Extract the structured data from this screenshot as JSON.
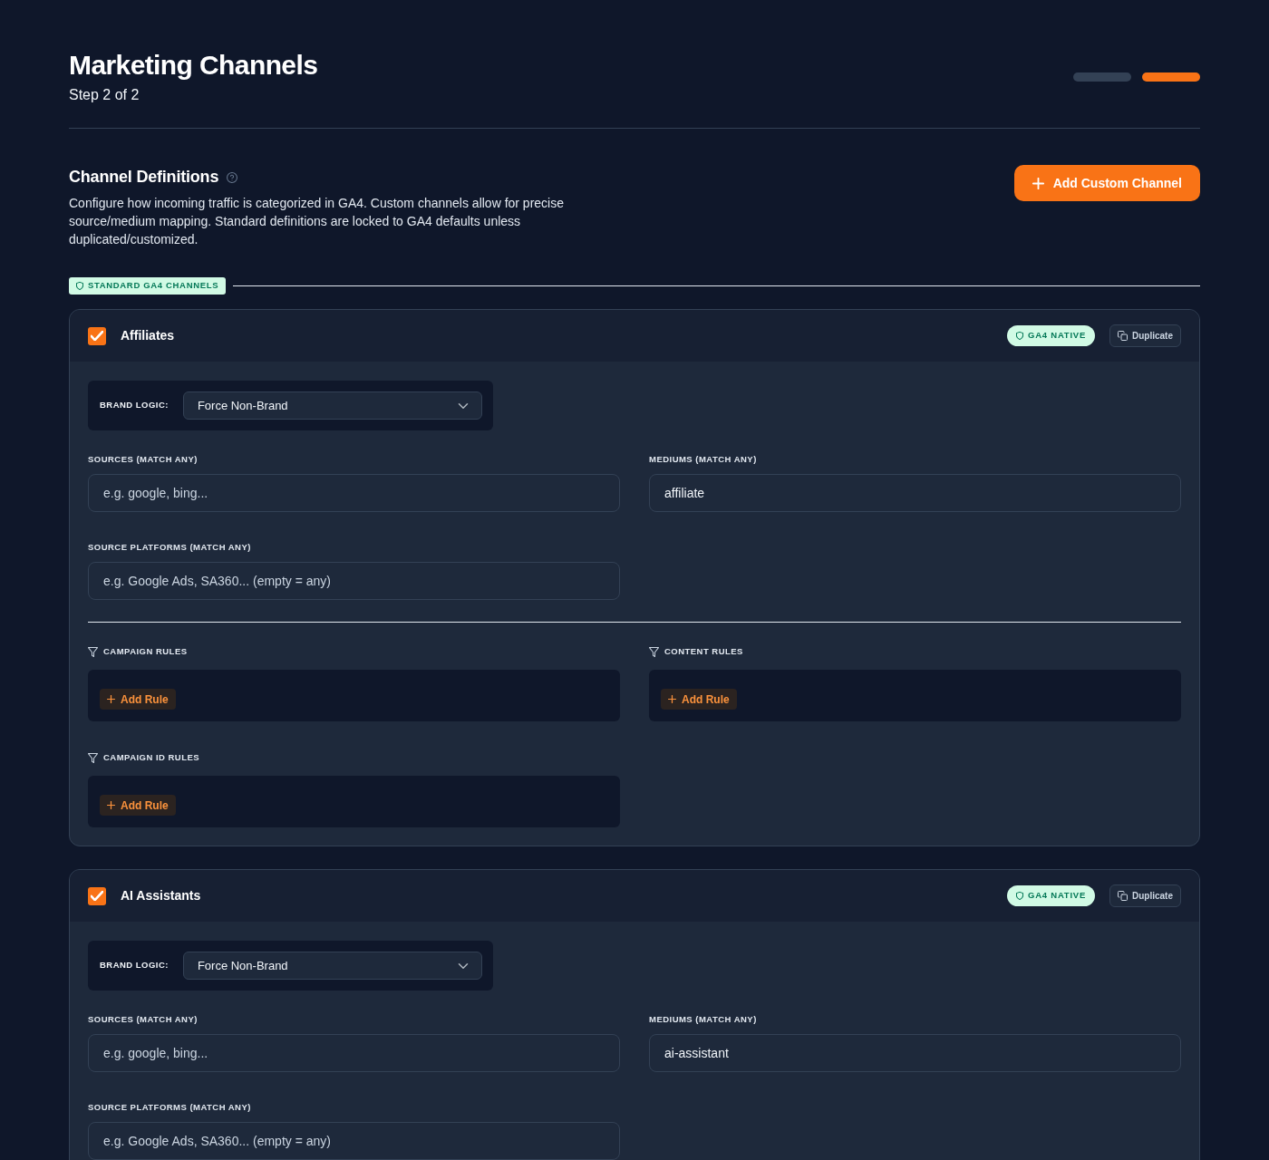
{
  "header": {
    "title": "Marketing Channels",
    "subtitle": "Step 2 of 2",
    "steps": [
      {
        "selected": false
      },
      {
        "selected": true
      }
    ]
  },
  "section": {
    "title": "Channel Definitions",
    "description": "Configure how incoming traffic is categorized in GA4. Custom channels allow for precise source/medium mapping. Standard definitions are locked to GA4 defaults unless duplicated/customized.",
    "add_button": "Add Custom Channel"
  },
  "groups": [
    {
      "label": "STANDARD GA4 CHANNELS",
      "channels": [
        {
          "name": "Affiliates",
          "checked": true,
          "badge": "GA4 NATIVE",
          "duplicate_button": "Duplicate",
          "brand_logic": {
            "label": "BRAND LOGIC:",
            "value": "Force Non-Brand"
          },
          "fields": [
            {
              "label": "SOURCES (MATCH ANY)",
              "placeholder": "e.g. google, bing..."
            },
            {
              "label": "MEDIUMS (MATCH ANY)",
              "value": "affiliate"
            },
            {
              "label": "SOURCE PLATFORMS (MATCH ANY)",
              "placeholder": "e.g. Google Ads, SA360... (empty = any)"
            }
          ],
          "rules": [
            {
              "label": "CAMPAIGN RULES",
              "button": "Add Rule"
            },
            {
              "label": "CONTENT RULES",
              "button": "Add Rule"
            },
            {
              "label": "CAMPAIGN ID RULES",
              "button": "Add Rule"
            }
          ]
        },
        {
          "name": "AI Assistants",
          "checked": true,
          "badge": "GA4 NATIVE",
          "duplicate_button": "Duplicate",
          "brand_logic": {
            "label": "BRAND LOGIC:",
            "value": "Force Non-Brand"
          },
          "fields": [
            {
              "label": "SOURCES (MATCH ANY)",
              "placeholder": "e.g. google, bing..."
            },
            {
              "label": "MEDIUMS (MATCH ANY)",
              "value": "ai-assistant"
            },
            {
              "label": "SOURCE PLATFORMS (MATCH ANY)",
              "placeholder": "e.g. Google Ads, SA360... (empty = any)"
            }
          ]
        }
      ]
    }
  ]
}
